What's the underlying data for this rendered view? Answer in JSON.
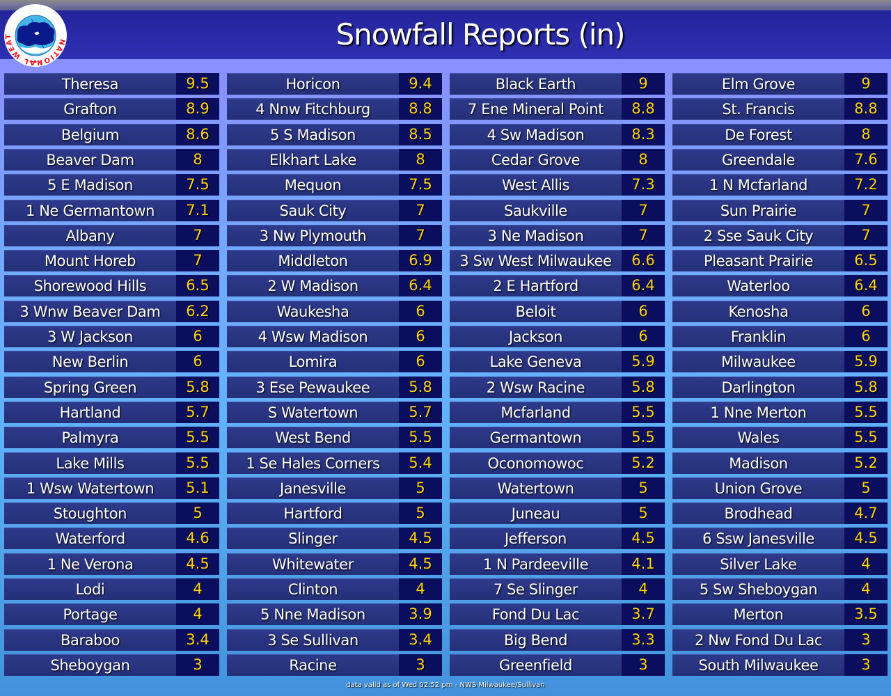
{
  "header": {
    "title": "Snowfall Reports (in)",
    "logo_text": "NATIONAL WEATHER SERVICE"
  },
  "footer": {
    "text": "data valid as of Wed 02:52 pm - NWS Milwaukee/Sullivan"
  },
  "colors": {
    "header_bg": "#2a2cac",
    "cell_name_bg": "#2a3582",
    "cell_value_bg": "#0a0e5c",
    "value_text": "#ffd21a",
    "name_text": "#ffffff"
  },
  "columns": [
    [
      {
        "location": "Theresa",
        "snowfall": "9.5"
      },
      {
        "location": "Grafton",
        "snowfall": "8.9"
      },
      {
        "location": "Belgium",
        "snowfall": "8.6"
      },
      {
        "location": "Beaver Dam",
        "snowfall": "8"
      },
      {
        "location": "5 E Madison",
        "snowfall": "7.5"
      },
      {
        "location": "1 Ne Germantown",
        "snowfall": "7.1"
      },
      {
        "location": "Albany",
        "snowfall": "7"
      },
      {
        "location": "Mount Horeb",
        "snowfall": "7"
      },
      {
        "location": "Shorewood Hills",
        "snowfall": "6.5"
      },
      {
        "location": "3 Wnw Beaver Dam",
        "snowfall": "6.2"
      },
      {
        "location": "3 W Jackson",
        "snowfall": "6"
      },
      {
        "location": "New Berlin",
        "snowfall": "6"
      },
      {
        "location": "Spring Green",
        "snowfall": "5.8"
      },
      {
        "location": "Hartland",
        "snowfall": "5.7"
      },
      {
        "location": "Palmyra",
        "snowfall": "5.5"
      },
      {
        "location": "Lake Mills",
        "snowfall": "5.5"
      },
      {
        "location": "1 Wsw Watertown",
        "snowfall": "5.1"
      },
      {
        "location": "Stoughton",
        "snowfall": "5"
      },
      {
        "location": "Waterford",
        "snowfall": "4.6"
      },
      {
        "location": "1 Ne Verona",
        "snowfall": "4.5"
      },
      {
        "location": "Lodi",
        "snowfall": "4"
      },
      {
        "location": "Portage",
        "snowfall": "4"
      },
      {
        "location": "Baraboo",
        "snowfall": "3.4"
      },
      {
        "location": "Sheboygan",
        "snowfall": "3"
      }
    ],
    [
      {
        "location": "Horicon",
        "snowfall": "9.4"
      },
      {
        "location": "4 Nnw Fitchburg",
        "snowfall": "8.8"
      },
      {
        "location": "5 S Madison",
        "snowfall": "8.5"
      },
      {
        "location": "Elkhart Lake",
        "snowfall": "8"
      },
      {
        "location": "Mequon",
        "snowfall": "7.5"
      },
      {
        "location": "Sauk City",
        "snowfall": "7"
      },
      {
        "location": "3 Nw Plymouth",
        "snowfall": "7"
      },
      {
        "location": "Middleton",
        "snowfall": "6.9"
      },
      {
        "location": "2 W Madison",
        "snowfall": "6.4"
      },
      {
        "location": "Waukesha",
        "snowfall": "6"
      },
      {
        "location": "4 Wsw Madison",
        "snowfall": "6"
      },
      {
        "location": "Lomira",
        "snowfall": "6"
      },
      {
        "location": "3 Ese Pewaukee",
        "snowfall": "5.8"
      },
      {
        "location": "S Watertown",
        "snowfall": "5.7"
      },
      {
        "location": "West Bend",
        "snowfall": "5.5"
      },
      {
        "location": "1 Se Hales Corners",
        "snowfall": "5.4"
      },
      {
        "location": "Janesville",
        "snowfall": "5"
      },
      {
        "location": "Hartford",
        "snowfall": "5"
      },
      {
        "location": "Slinger",
        "snowfall": "4.5"
      },
      {
        "location": "Whitewater",
        "snowfall": "4.5"
      },
      {
        "location": "Clinton",
        "snowfall": "4"
      },
      {
        "location": "5 Nne Madison",
        "snowfall": "3.9"
      },
      {
        "location": "3 Se Sullivan",
        "snowfall": "3.4"
      },
      {
        "location": "Racine",
        "snowfall": "3"
      }
    ],
    [
      {
        "location": "Black Earth",
        "snowfall": "9"
      },
      {
        "location": "7 Ene Mineral Point",
        "snowfall": "8.8"
      },
      {
        "location": "4 Sw Madison",
        "snowfall": "8.3"
      },
      {
        "location": "Cedar Grove",
        "snowfall": "8"
      },
      {
        "location": "West Allis",
        "snowfall": "7.3"
      },
      {
        "location": "Saukville",
        "snowfall": "7"
      },
      {
        "location": "3 Ne Madison",
        "snowfall": "7"
      },
      {
        "location": "3 Sw West Milwaukee",
        "snowfall": "6.6"
      },
      {
        "location": "2 E Hartford",
        "snowfall": "6.4"
      },
      {
        "location": "Beloit",
        "snowfall": "6"
      },
      {
        "location": "Jackson",
        "snowfall": "6"
      },
      {
        "location": "Lake Geneva",
        "snowfall": "5.9"
      },
      {
        "location": "2 Wsw Racine",
        "snowfall": "5.8"
      },
      {
        "location": "Mcfarland",
        "snowfall": "5.5"
      },
      {
        "location": "Germantown",
        "snowfall": "5.5"
      },
      {
        "location": "Oconomowoc",
        "snowfall": "5.2"
      },
      {
        "location": "Watertown",
        "snowfall": "5"
      },
      {
        "location": "Juneau",
        "snowfall": "5"
      },
      {
        "location": "Jefferson",
        "snowfall": "4.5"
      },
      {
        "location": "1 N Pardeeville",
        "snowfall": "4.1"
      },
      {
        "location": "7 Se Slinger",
        "snowfall": "4"
      },
      {
        "location": "Fond Du Lac",
        "snowfall": "3.7"
      },
      {
        "location": "Big Bend",
        "snowfall": "3.3"
      },
      {
        "location": "Greenfield",
        "snowfall": "3"
      }
    ],
    [
      {
        "location": "Elm Grove",
        "snowfall": "9"
      },
      {
        "location": "St. Francis",
        "snowfall": "8.8"
      },
      {
        "location": "De Forest",
        "snowfall": "8"
      },
      {
        "location": "Greendale",
        "snowfall": "7.6"
      },
      {
        "location": "1 N Mcfarland",
        "snowfall": "7.2"
      },
      {
        "location": "Sun Prairie",
        "snowfall": "7"
      },
      {
        "location": "2 Sse Sauk City",
        "snowfall": "7"
      },
      {
        "location": "Pleasant Prairie",
        "snowfall": "6.5"
      },
      {
        "location": "Waterloo",
        "snowfall": "6.4"
      },
      {
        "location": "Kenosha",
        "snowfall": "6"
      },
      {
        "location": "Franklin",
        "snowfall": "6"
      },
      {
        "location": "Milwaukee",
        "snowfall": "5.9"
      },
      {
        "location": "Darlington",
        "snowfall": "5.8"
      },
      {
        "location": "1 Nne Merton",
        "snowfall": "5.5"
      },
      {
        "location": "Wales",
        "snowfall": "5.5"
      },
      {
        "location": "Madison",
        "snowfall": "5.2"
      },
      {
        "location": "Union Grove",
        "snowfall": "5"
      },
      {
        "location": "Brodhead",
        "snowfall": "4.7"
      },
      {
        "location": "6 Ssw Janesville",
        "snowfall": "4.5"
      },
      {
        "location": "Silver Lake",
        "snowfall": "4"
      },
      {
        "location": "5 Sw Sheboygan",
        "snowfall": "4"
      },
      {
        "location": "Merton",
        "snowfall": "3.5"
      },
      {
        "location": "2 Nw Fond Du Lac",
        "snowfall": "3"
      },
      {
        "location": "South Milwaukee",
        "snowfall": "3"
      }
    ]
  ]
}
